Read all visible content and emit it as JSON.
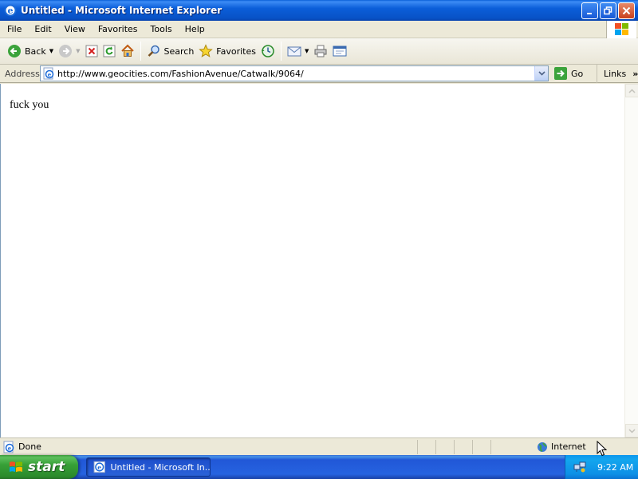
{
  "window": {
    "title": "Untitled - Microsoft Internet Explorer",
    "icon": "ie-icon"
  },
  "menu": {
    "items": [
      "File",
      "Edit",
      "View",
      "Favorites",
      "Tools",
      "Help"
    ]
  },
  "toolbar": {
    "back_label": "Back",
    "search_label": "Search",
    "favorites_label": "Favorites"
  },
  "address": {
    "label": "Address",
    "url": "http://www.geocities.com/FashionAvenue/Catwalk/9064/",
    "go_label": "Go",
    "links_label": "Links"
  },
  "page": {
    "body_text": "fuck you"
  },
  "status": {
    "text": "Done",
    "zone": "Internet"
  },
  "taskbar": {
    "start_label": "start",
    "task_label": "Untitled - Microsoft In...",
    "clock": "9:22 AM"
  },
  "colors": {
    "titlebar": "#0b5ed9",
    "taskbar": "#2663e0",
    "start_button": "#37a037",
    "tray": "#0d8fe6"
  }
}
